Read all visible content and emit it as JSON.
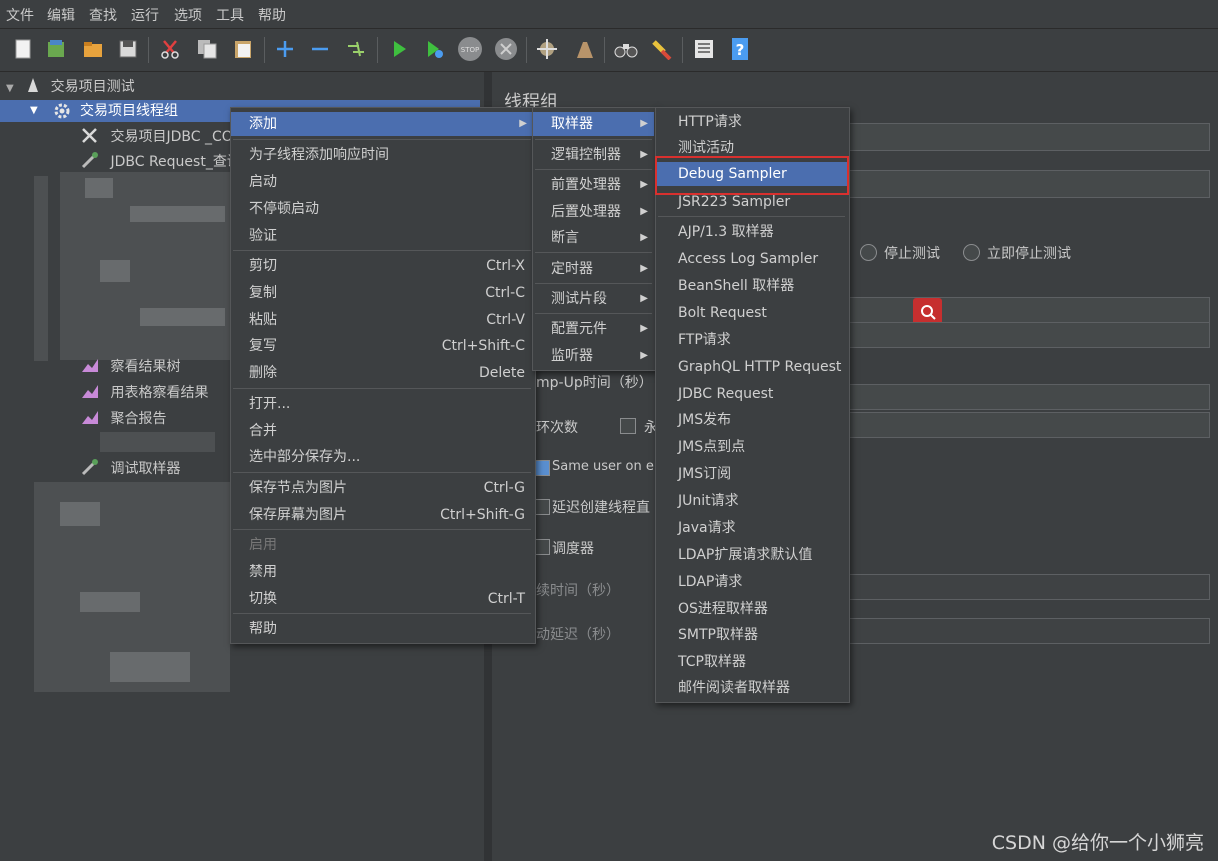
{
  "menubar": [
    "文件",
    "编辑",
    "查找",
    "运行",
    "选项",
    "工具",
    "帮助"
  ],
  "toolbar": {
    "icons": [
      "new-icon",
      "templates-icon",
      "open-icon",
      "save-icon",
      "cut-icon",
      "copy-icon",
      "paste-icon",
      "expand-icon",
      "collapse-icon",
      "toggle-icon",
      "start-icon",
      "start-no-pause-icon",
      "stop-icon",
      "shutdown-icon",
      "clear-icon",
      "clear-all-icon",
      "search-icon",
      "reset-search-icon",
      "function-helper-icon",
      "help-icon"
    ]
  },
  "tree": {
    "root": "交易项目测试",
    "thread_group": "交易项目线程组",
    "jdbc_config": "交易项目JDBC _CO",
    "jdbc_request": "JDBC Request_查询",
    "view_results_tree": "察看结果树",
    "graph_results": "用表格察看结果",
    "aggregate_report": "聚合报告",
    "debug_sampler": "调试取样器"
  },
  "right_panel": {
    "title": "线程组",
    "stop_test": "停止测试",
    "stop_test_now": "立即停止测试",
    "ramp_up": "mp-Up时间（秒）",
    "loop_count": "环次数",
    "forever_fragment": "永",
    "same_user": "Same user on e",
    "delay_create": "延迟创建线程直",
    "scheduler": "调度器",
    "duration": "续时间（秒）",
    "startup_delay": "动延迟（秒）"
  },
  "context_menu": {
    "items": [
      {
        "label": "添加",
        "submenu": true
      },
      {
        "label": "为子线程添加响应时间"
      },
      {
        "label": "启动"
      },
      {
        "label": "不停顿启动"
      },
      {
        "label": "验证"
      },
      {
        "label": "剪切",
        "shortcut": "Ctrl-X"
      },
      {
        "label": "复制",
        "shortcut": "Ctrl-C"
      },
      {
        "label": "粘贴",
        "shortcut": "Ctrl-V"
      },
      {
        "label": "复写",
        "shortcut": "Ctrl+Shift-C"
      },
      {
        "label": "删除",
        "shortcut": "Delete"
      },
      {
        "label": "打开..."
      },
      {
        "label": "合并"
      },
      {
        "label": "选中部分保存为..."
      },
      {
        "label": "保存节点为图片",
        "shortcut": "Ctrl-G"
      },
      {
        "label": "保存屏幕为图片",
        "shortcut": "Ctrl+Shift-G"
      },
      {
        "label": "启用"
      },
      {
        "label": "禁用"
      },
      {
        "label": "切换",
        "shortcut": "Ctrl-T"
      },
      {
        "label": "帮助"
      }
    ]
  },
  "add_menu": {
    "items": [
      "取样器",
      "逻辑控制器",
      "前置处理器",
      "后置处理器",
      "断言",
      "定时器",
      "测试片段",
      "配置元件",
      "监听器"
    ]
  },
  "sampler_menu": {
    "items": [
      "HTTP请求",
      "测试活动",
      "Debug Sampler",
      "JSR223 Sampler",
      "AJP/1.3 取样器",
      "Access Log Sampler",
      "BeanShell 取样器",
      "Bolt Request",
      "FTP请求",
      "GraphQL HTTP Request",
      "JDBC Request",
      "JMS发布",
      "JMS点到点",
      "JMS订阅",
      "JUnit请求",
      "Java请求",
      "LDAP扩展请求默认值",
      "LDAP请求",
      "OS进程取样器",
      "SMTP取样器",
      "TCP取样器",
      "邮件阅读者取样器"
    ],
    "highlighted": "Debug Sampler"
  },
  "watermark": "CSDN @给你一个小狮亮",
  "colors": {
    "background": "#3c3f41",
    "selection": "#4b6eaf",
    "highlight_box": "#d9302e",
    "search_button": "#c62f2f"
  }
}
